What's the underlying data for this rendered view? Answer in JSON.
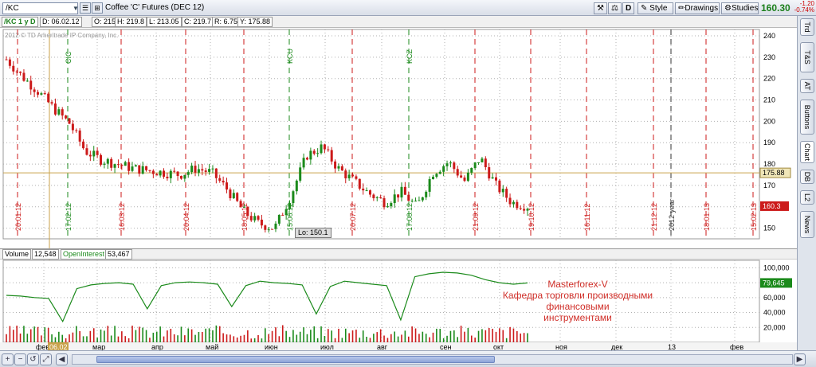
{
  "toolbar": {
    "symbol": "/KC",
    "title": "Coffee 'C' Futures (DEC 12)",
    "d_button": "D",
    "style": "Style",
    "drawings": "Drawings",
    "studies": "Studies",
    "last_price": "160.30",
    "change": "-1.20",
    "change_pct": "-0.74%"
  },
  "infobar": {
    "symbol_period": "/KC 1 y D",
    "date": "D: 06.02.12",
    "open": "O: 215",
    "high": "H: 219.8",
    "low": "L: 213.05",
    "close": "C: 219.7",
    "range": "R: 6.75",
    "y": "Y: 175.88"
  },
  "copyright": "2012 © TD Ameritrade IP Company, Inc.",
  "sidebar_tabs": [
    "Trd",
    "T&S",
    "AT",
    "Buttons",
    "Chart",
    "DB",
    "L2",
    "News"
  ],
  "sidebar_active": "Chart",
  "chart_data": [
    {
      "type": "candlestick",
      "series": [
        {
          "name": "/KC",
          "values": [
            229,
            221,
            214,
            206,
            199,
            186,
            182,
            180,
            178,
            177,
            176,
            175,
            178,
            176,
            168,
            158,
            152,
            150.1,
            165,
            184,
            188,
            178,
            172,
            166,
            162,
            167,
            160,
            176,
            181,
            172,
            183,
            170,
            162,
            160.3
          ]
        }
      ],
      "y_ticks": [
        "240",
        "230",
        "220",
        "210",
        "200",
        "190",
        "180",
        "170",
        "160",
        "150"
      ],
      "ylim": [
        145,
        243
      ],
      "crosshair_y": "175.88",
      "last_label": "160.3",
      "low_label": "Lo: 150.1",
      "event_labels": [
        "CIC",
        "KCU",
        "KCZ"
      ],
      "date_labels": [
        "20.01.12",
        "17.02.12",
        "16.03.12",
        "20.04.12",
        "18.05.12",
        "15.06.12",
        "20.07.12",
        "17.08.12",
        "21.09.12",
        "19.10.12",
        "16.11.12",
        "21.12.12",
        "2012 year",
        "18.01.13",
        "15.02.13"
      ]
    },
    {
      "type": "line",
      "series": [
        {
          "name": "OpenInterest",
          "values": [
            63,
            62,
            60,
            59,
            28,
            72,
            77,
            79,
            80,
            78,
            45,
            76,
            80,
            81,
            80,
            78,
            48,
            76,
            82,
            80,
            79,
            77,
            38,
            75,
            82,
            80,
            78,
            76,
            30,
            88,
            92,
            94,
            93,
            90,
            84,
            80,
            78,
            79.645
          ]
        }
      ],
      "y_ticks": [
        "100,000",
        "80,000",
        "60,000",
        "40,000",
        "20,000"
      ],
      "ylim": [
        0,
        110
      ],
      "last_label": "79,645"
    }
  ],
  "volume_bar": {
    "label": "Volume",
    "value": "12,548",
    "oi_label": "OpenInterest",
    "oi_value": "53,467"
  },
  "x_axis": {
    "labels": [
      "фев",
      "мар",
      "апр",
      "май",
      "июн",
      "июл",
      "авг",
      "сен",
      "окт",
      "ноя",
      "дек",
      "13",
      "фев"
    ],
    "cursor_label": "06.02"
  },
  "watermark": {
    "line1": "Masterforex-V",
    "line2": "Кафедра торговли производными финансовыми",
    "line3": "инструментами"
  },
  "colors": {
    "up": "#1b8a1b",
    "down": "#cc1a1a",
    "price_green": "#1b7f1b",
    "grid": "#b0b0b0",
    "event_red": "#cc1a1a",
    "event_green": "#1b8a1b"
  }
}
